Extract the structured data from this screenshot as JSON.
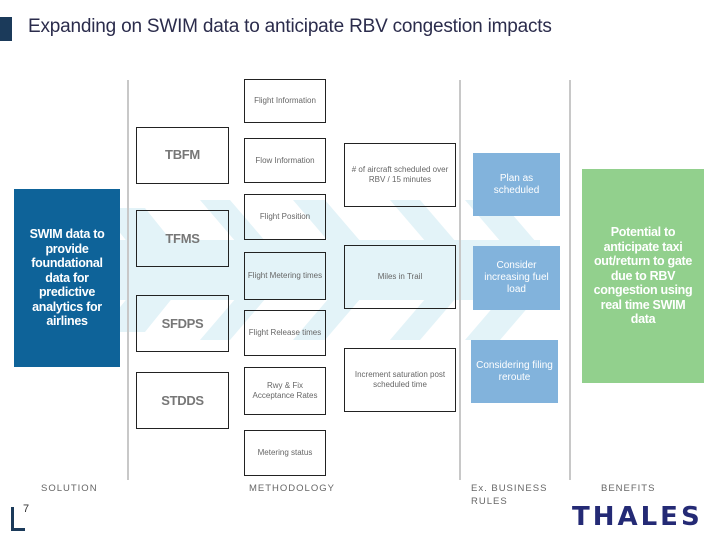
{
  "header": {
    "title": "Expanding on SWIM data to anticipate RBV congestion impacts"
  },
  "solution": {
    "text": "SWIM data to provide foundational data for predictive analytics for airlines"
  },
  "systems": [
    {
      "label": "TBFM"
    },
    {
      "label": "TFMS"
    },
    {
      "label": "SFDPS"
    },
    {
      "label": "STDDS"
    }
  ],
  "data_items": [
    {
      "label": "Flight Information"
    },
    {
      "label": "Flow Information"
    },
    {
      "label": "Flight Position"
    },
    {
      "label": "Flight Metering times"
    },
    {
      "label": "Flight Release times"
    },
    {
      "label": "Rwy & Fix Acceptance Rates"
    },
    {
      "label": "Metering status"
    }
  ],
  "metrics": [
    {
      "label": "# of aircraft scheduled over RBV / 15 minutes"
    },
    {
      "label": "Miles in Trail"
    },
    {
      "label": "Increment saturation post scheduled time"
    }
  ],
  "business_rules": [
    {
      "label": "Plan as scheduled"
    },
    {
      "label": "Consider increasing fuel load"
    },
    {
      "label": "Considering filing reroute"
    }
  ],
  "benefit": {
    "text": "Potential to anticipate taxi out/return to gate due to RBV congestion using real time SWIM data"
  },
  "column_labels": {
    "solution": "SOLUTION",
    "methodology": "METHODOLOGY",
    "business_rules": "Ex. BUSINESS RULES",
    "benefits": "BENEFITS"
  },
  "footer": {
    "page_number": "7",
    "logo": "THALES"
  },
  "colors": {
    "title_accent": "#1b3a5a",
    "solution_fill": "#0e6399",
    "rule_fill": "#82b3dc",
    "benefit_fill": "#92d08d",
    "arrow_fill": "#e3f3f8",
    "logo": "#242a75"
  }
}
